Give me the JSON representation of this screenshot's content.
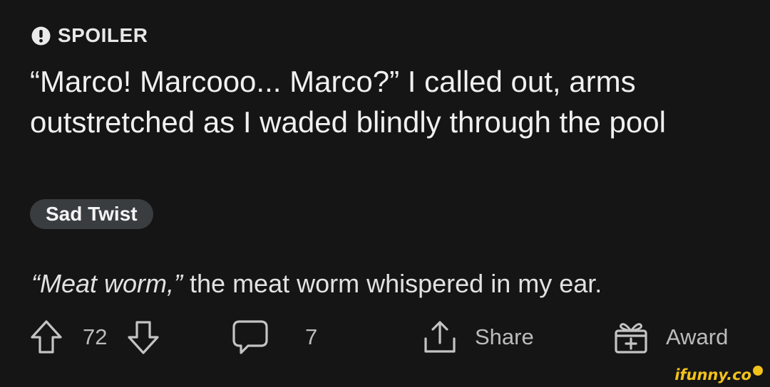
{
  "post": {
    "spoiler_label": "SPOILER",
    "title": "“Marco! Marcooo... Marco?” I called out, arms outstretched as I waded blindly through the pool",
    "flair": "Sad Twist",
    "body_italic": "“Meat worm,”",
    "body_rest": " the meat worm whispered in my ear."
  },
  "actions": {
    "vote_count": "72",
    "comment_count": "7",
    "share_label": "Share",
    "award_label": "Award"
  },
  "watermark": {
    "text": "ifunny.co"
  },
  "colors": {
    "background": "#151515",
    "text": "#f0f0f0",
    "muted": "#bcbcbc",
    "flair_bg": "#3a3d40",
    "watermark": "#f2c21b"
  },
  "icons": [
    "spoiler-alert-icon",
    "upvote-icon",
    "downvote-icon",
    "comment-icon",
    "share-icon",
    "award-icon"
  ]
}
